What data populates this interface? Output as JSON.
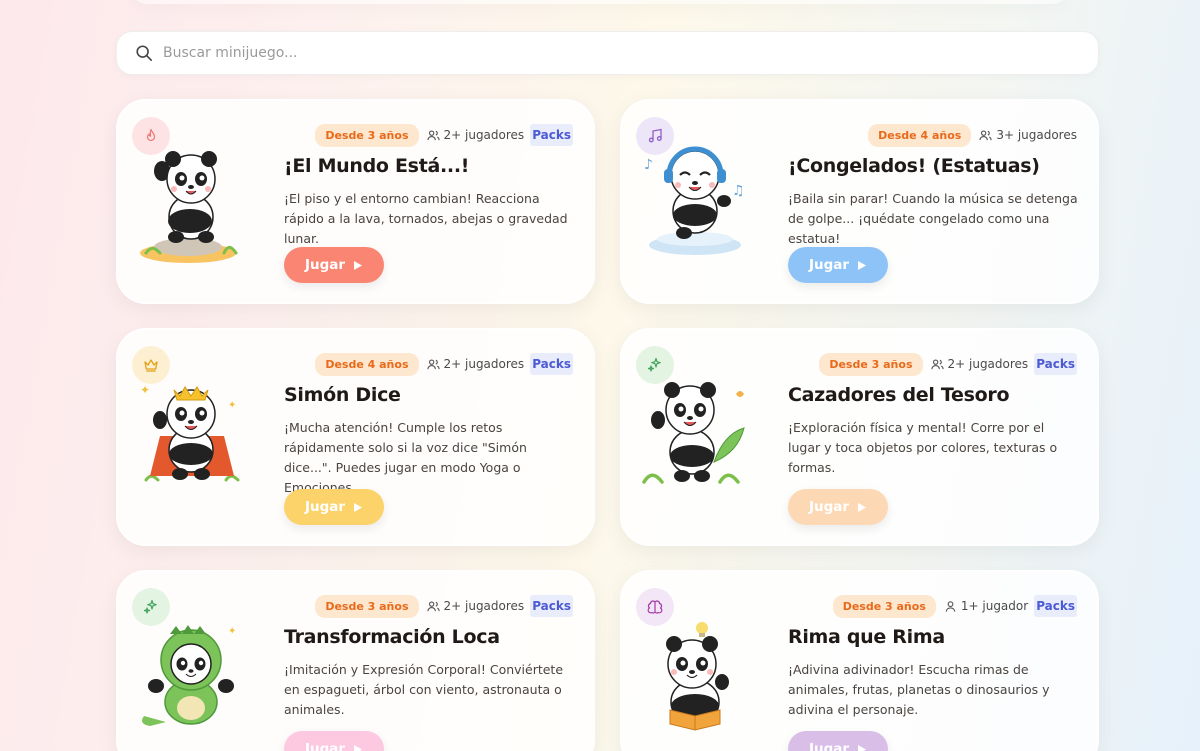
{
  "search": {
    "placeholder": "Buscar minijuego..."
  },
  "colors": {
    "age_bg": "#fde7cf",
    "age_text": "#e86a1a",
    "packs_text": "#4c5bd4"
  },
  "cards": [
    {
      "title": "¡El Mundo Está...!",
      "description": "¡El piso y el entorno cambian! Reacciona rápido a la lava, tornados, abejas o gravedad lunar.",
      "age": "Desde 3 años",
      "players": "2+ jugadores",
      "packs": "Packs",
      "button": "Jugar",
      "icon": "fire-icon",
      "accent": "#fa8572"
    },
    {
      "title": "¡Congelados! (Estatuas)",
      "description": "¡Baila sin parar! Cuando la música se detenga de golpe... ¡quédate congelado como una estatua!",
      "age": "Desde 4 años",
      "players": "3+ jugadores",
      "packs": "",
      "button": "Jugar",
      "icon": "music-icon",
      "accent": "#8ec3f8"
    },
    {
      "title": "Simón Dice",
      "description": "¡Mucha atención! Cumple los retos rápidamente solo si la voz dice \"Simón dice...\". Puedes jugar en modo Yoga o Emociones.",
      "age": "Desde 4 años",
      "players": "2+ jugadores",
      "packs": "Packs",
      "button": "Jugar",
      "icon": "crown-icon",
      "accent": "#fcd36a"
    },
    {
      "title": "Cazadores del Tesoro",
      "description": "¡Exploración física y mental! Corre por el lugar y toca objetos por colores, texturas o formas.",
      "age": "Desde 3 años",
      "players": "2+ jugadores",
      "packs": "Packs",
      "button": "Jugar",
      "icon": "sparkle-icon",
      "accent": "#fdd8b4"
    },
    {
      "title": "Transformación Loca",
      "description": "¡Imitación y Expresión Corporal! Conviértete en espagueti, árbol con viento, astronauta o animales.",
      "age": "Desde 3 años",
      "players": "2+ jugadores",
      "packs": "Packs",
      "button": "Jugar",
      "icon": "sparkle-icon",
      "accent": "#fcc9e0"
    },
    {
      "title": "Rima que Rima",
      "description": "¡Adivina adivinador! Escucha rimas de animales, frutas, planetas o dinosaurios y adivina el personaje.",
      "age": "Desde 3 años",
      "players": "1+ jugador",
      "packs": "Packs",
      "button": "Jugar",
      "icon": "brain-icon",
      "accent": "#d9bfe8"
    }
  ]
}
